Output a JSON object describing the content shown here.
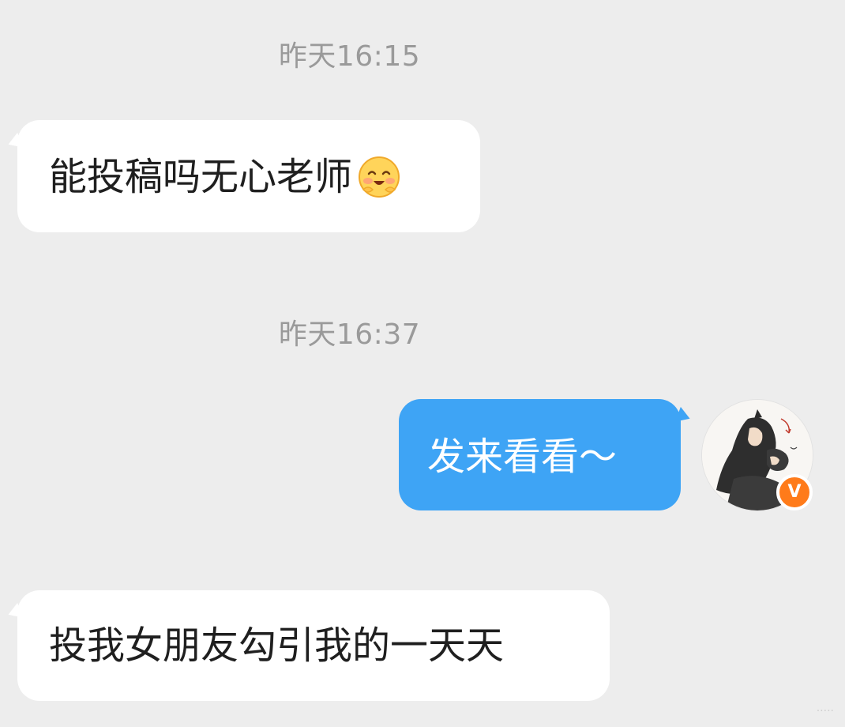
{
  "messages": [
    {
      "timestamp": "昨天16:15",
      "direction": "incoming",
      "text": "能投稿吗无心老师",
      "emoji": "smiling-blush-emoji"
    },
    {
      "timestamp": "昨天16:37",
      "direction": "outgoing",
      "text": "发来看看～"
    },
    {
      "direction": "incoming",
      "text": "投我女朋友勾引我的一天天"
    }
  ],
  "avatar": {
    "badge": "V",
    "badge_color": "#ff7b1a"
  },
  "colors": {
    "background": "#ededed",
    "incoming_bubble": "#ffffff",
    "outgoing_bubble": "#3ea4f5",
    "timestamp_text": "#9a9a9a"
  },
  "watermark": "·····"
}
